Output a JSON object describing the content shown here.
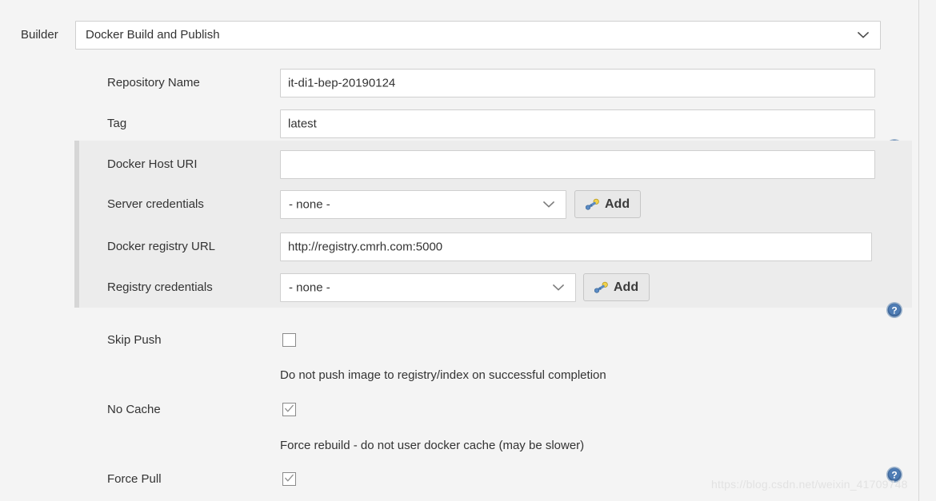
{
  "builder": {
    "label": "Builder",
    "selected": "Docker Build and Publish",
    "chevron_icon": "chevron-down-icon"
  },
  "fields": {
    "repository_name": {
      "label": "Repository Name",
      "value": "it-di1-bep-20190124",
      "help_icon": "help-icon"
    },
    "tag": {
      "label": "Tag",
      "value": "latest"
    },
    "docker_host_uri": {
      "label": "Docker Host URI",
      "value": "",
      "placeholder": "",
      "help_icon": "help-icon"
    },
    "server_credentials": {
      "label": "Server credentials",
      "value": "- none -",
      "add_button": "Add",
      "key_icon": "key-icon"
    },
    "docker_registry_url": {
      "label": "Docker registry URL",
      "value": "http://registry.cmrh.com:5000",
      "help_icon": "help-icon"
    },
    "registry_credentials": {
      "label": "Registry credentials",
      "value": "- none -",
      "add_button": "Add",
      "key_icon": "key-icon"
    }
  },
  "checkboxes": {
    "skip_push": {
      "label": "Skip Push",
      "checked": false,
      "description": "Do not push image to registry/index on successful completion"
    },
    "no_cache": {
      "label": "No Cache",
      "checked": true,
      "description": "Force rebuild - do not user docker cache (may be slower)"
    },
    "force_pull": {
      "label": "Force Pull",
      "checked": true,
      "description": ""
    }
  },
  "watermark": {
    "text": "https://blog.csdn.net/weixin_41709748"
  },
  "colors": {
    "page_background": "#f4f4f4",
    "panel_background": "#ececec",
    "panel_accent": "#d6d6d6",
    "input_background": "#ffffff",
    "input_border": "#cfcfcf",
    "text": "#333333",
    "help_icon_blue": "#4a6f9e",
    "key_icon_blue": "#5b8bc4",
    "key_icon_yellow": "#f2d24b"
  }
}
